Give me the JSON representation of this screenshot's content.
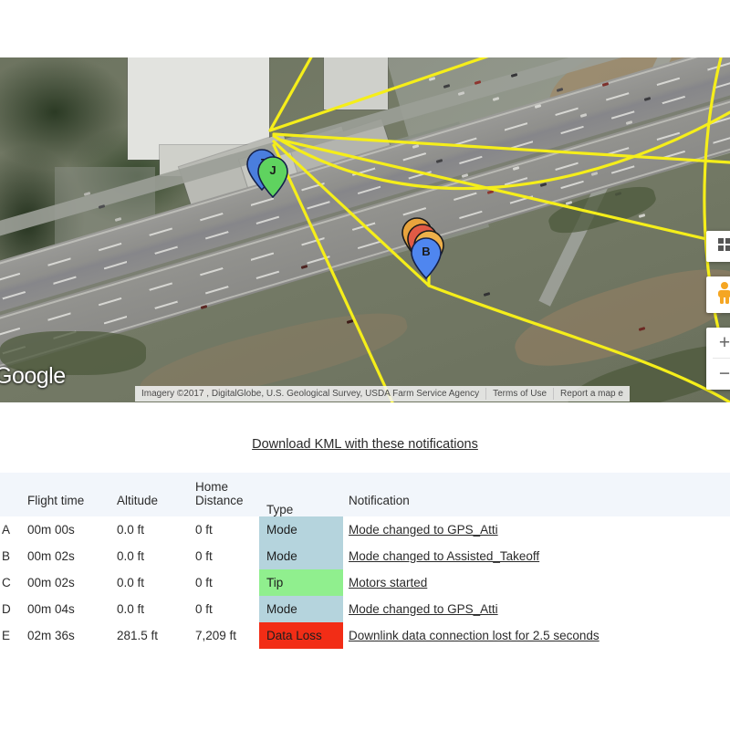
{
  "map": {
    "provider_logo": "Google",
    "attribution": "Imagery ©2017 , DigitalGlobe, U.S. Geological Survey, USDA Farm Service Agency",
    "terms_label": "Terms of Use",
    "report_label": "Report a map e",
    "zoom_in_label": "+",
    "zoom_out_label": "−",
    "markers": [
      {
        "label": "J",
        "color": "#4a7ede"
      },
      {
        "label": "J",
        "color": "#5fd35f"
      },
      {
        "label": "B",
        "color": "#e8a33d"
      },
      {
        "label": "B",
        "color": "#e05a45"
      },
      {
        "label": "B",
        "color": "#edb04a"
      },
      {
        "label": "B",
        "color": "#4f86ef"
      }
    ],
    "path_color": "#f5ee1a",
    "controls": {
      "maptype": "map-type-icon",
      "pegman": "pegman-streetview-icon"
    }
  },
  "kml": {
    "link_label": "Download KML with these notifications"
  },
  "table": {
    "columns": [
      "",
      "Flight time",
      "Altitude",
      "Home Distance",
      "Type",
      "Notification"
    ],
    "header_home_distance_line1": "Home",
    "header_home_distance_line2": "Distance",
    "type_colors": {
      "Mode": "#b5d4dd",
      "Tip": "#90ef8e",
      "Data Loss": "#f22d16"
    },
    "rows": [
      {
        "letter": "A",
        "flight_time": "00m 00s",
        "altitude": "0.0 ft",
        "home_distance": "0 ft",
        "type": "Mode",
        "notification": "Mode changed to GPS_Atti"
      },
      {
        "letter": "B",
        "flight_time": "00m 02s",
        "altitude": "0.0 ft",
        "home_distance": "0 ft",
        "type": "Mode",
        "notification": "Mode changed to Assisted_Takeoff"
      },
      {
        "letter": "C",
        "flight_time": "00m 02s",
        "altitude": "0.0 ft",
        "home_distance": "0 ft",
        "type": "Tip",
        "notification": "Motors started"
      },
      {
        "letter": "D",
        "flight_time": "00m 04s",
        "altitude": "0.0 ft",
        "home_distance": "0 ft",
        "type": "Mode",
        "notification": "Mode changed to GPS_Atti"
      },
      {
        "letter": "E",
        "flight_time": "02m 36s",
        "altitude": "281.5 ft",
        "home_distance": "7,209 ft",
        "type": "Data Loss",
        "notification": "Downlink data connection lost for 2.5 seconds"
      }
    ]
  }
}
